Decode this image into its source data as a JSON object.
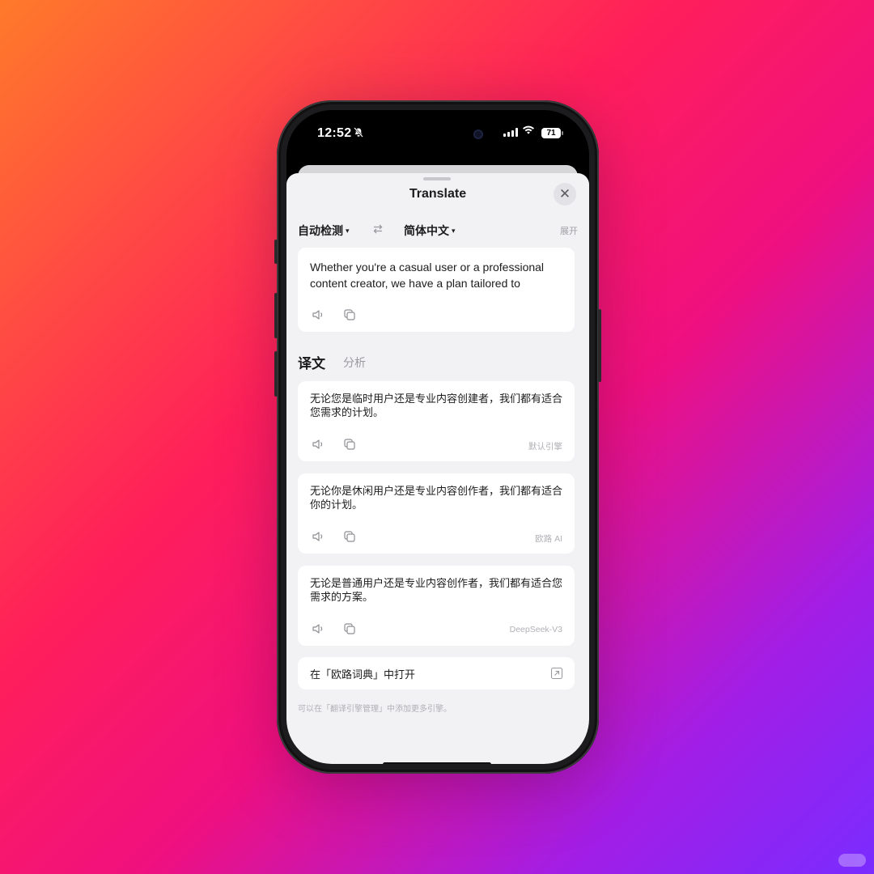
{
  "status_bar": {
    "time": "12:52",
    "battery": "71",
    "icons": [
      "bell-slash-icon",
      "signal-icon",
      "wifi-icon",
      "battery-icon"
    ]
  },
  "sheet": {
    "title": "Translate",
    "close_icon": "close-icon"
  },
  "languages": {
    "source": "自动检测",
    "target": "简体中文",
    "caret": "▾",
    "swap_icon": "swap-icon",
    "expand": "展开"
  },
  "input": {
    "text": "Whether you're a casual user or a professional content creator, we have a plan tailored to"
  },
  "tabs": {
    "active": "译文",
    "other": "分析"
  },
  "results": [
    {
      "text": "无论您是临时用户还是专业内容创建者，我们都有适合您需求的计划。",
      "engine": "默认引擎"
    },
    {
      "text": "无论你是休闲用户还是专业内容创作者，我们都有适合你的计划。",
      "engine": "欧路 AI"
    },
    {
      "text": "无论是普通用户还是专业内容创作者，我们都有适合您需求的方案。",
      "engine": "DeepSeek-V3"
    }
  ],
  "open_in": {
    "label": "在「欧路词典」中打开",
    "icon": "external-link-icon"
  },
  "footer_hint": "可以在「翻译引擎管理」中添加更多引擎。",
  "colors": {
    "sheet_bg": "#f2f2f4",
    "card_bg": "#ffffff",
    "text": "#1c1c1e",
    "muted": "#9a9aa0"
  }
}
